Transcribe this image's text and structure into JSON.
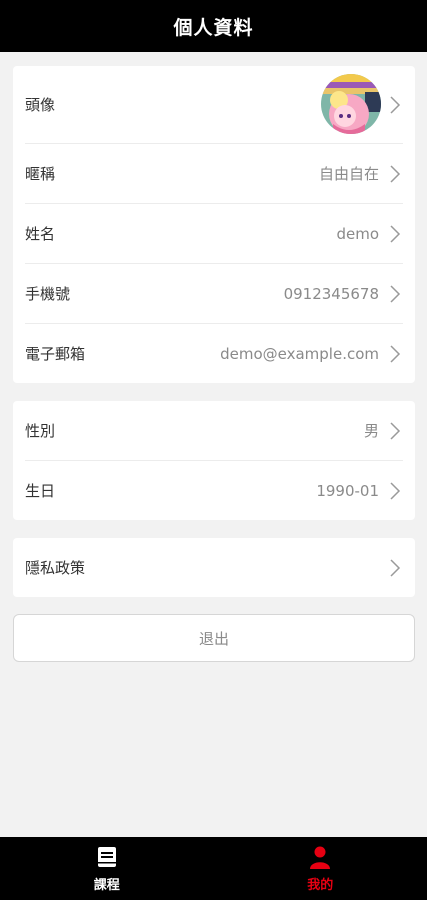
{
  "header": {
    "title": "個人資料"
  },
  "profile_card": {
    "avatar_label": "頭像",
    "nickname_label": "暱稱",
    "nickname_value": "自由自在",
    "name_label": "姓名",
    "name_value": "demo",
    "phone_label": "手機號",
    "phone_value": "0912345678",
    "email_label": "電子郵箱",
    "email_value": "demo@example.com"
  },
  "details_card": {
    "gender_label": "性別",
    "gender_value": "男",
    "birthday_label": "生日",
    "birthday_value": "1990-01"
  },
  "privacy": {
    "label": "隱私政策"
  },
  "logout": {
    "label": "退出"
  },
  "tabbar": {
    "tabs": [
      {
        "label": "課程",
        "icon": "book-icon",
        "active": false
      },
      {
        "label": "我的",
        "icon": "person-icon",
        "active": true
      }
    ]
  },
  "colors": {
    "header_bg": "#000000",
    "page_bg": "#f2f2f2",
    "active_tab": "#e60012",
    "inactive_tab": "#ffffff"
  }
}
